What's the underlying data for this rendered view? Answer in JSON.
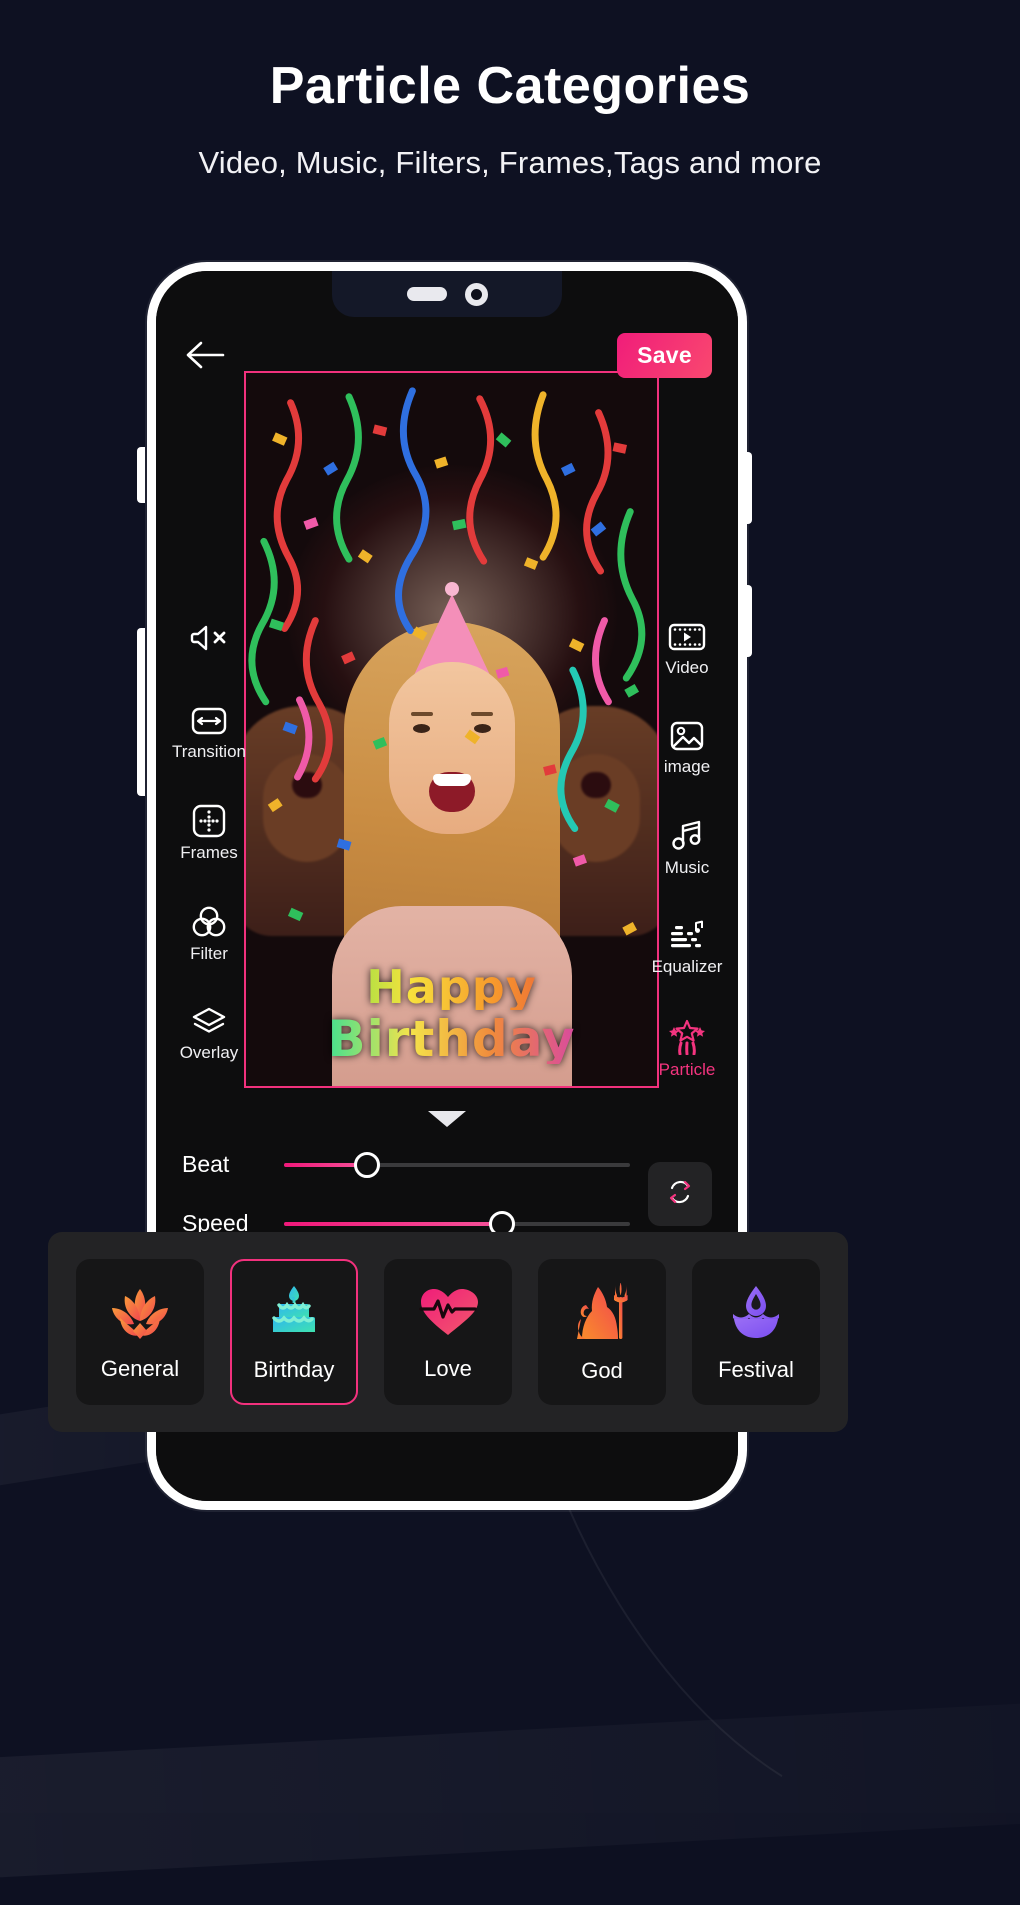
{
  "page": {
    "title": "Particle Categories",
    "subtitle": "Video, Music, Filters, Frames,Tags and more",
    "background_color": "#0e1122",
    "accent_color": "#f2317d"
  },
  "phone": {
    "notch": {
      "speaker_icon": "speaker-pill",
      "camera_icon": "front-camera-icon"
    },
    "side_buttons": [
      "volume-up",
      "volume-down",
      "power",
      "assistant"
    ]
  },
  "app_header": {
    "back_icon": "back-arrow-icon",
    "save_label": "Save"
  },
  "preview": {
    "border_color": "#f2317d",
    "overlay_text_line1": "Happy",
    "overlay_text_line2": "Birthday",
    "scene": "birthday-confetti-photo"
  },
  "left_toolbar": [
    {
      "icon": "mute-icon",
      "label": ""
    },
    {
      "icon": "transition-icon",
      "label": "Transition"
    },
    {
      "icon": "frames-icon",
      "label": "Frames"
    },
    {
      "icon": "filter-icon",
      "label": "Filter"
    },
    {
      "icon": "overlay-icon",
      "label": "Overlay"
    }
  ],
  "right_toolbar": [
    {
      "icon": "video-icon",
      "label": "Video",
      "active": false
    },
    {
      "icon": "image-icon",
      "label": "image",
      "active": false
    },
    {
      "icon": "music-icon",
      "label": "Music",
      "active": false
    },
    {
      "icon": "equalizer-icon",
      "label": "Equalizer",
      "active": false
    },
    {
      "icon": "particle-icon",
      "label": "Particle",
      "active": true
    }
  ],
  "collapse_chevron": "chevron-down-icon",
  "controls": {
    "sliders": [
      {
        "label": "Beat",
        "value": 24
      },
      {
        "label": "Speed",
        "value": 63
      }
    ],
    "reset_icon": "refresh-icon"
  },
  "categories": [
    {
      "label": "General",
      "icon": "lotus-icon",
      "selected": false
    },
    {
      "label": "Birthday",
      "icon": "cake-icon",
      "selected": true
    },
    {
      "label": "Love",
      "icon": "heartbeat-icon",
      "selected": false
    },
    {
      "label": "God",
      "icon": "shiva-icon",
      "selected": false
    },
    {
      "label": "Festival",
      "icon": "diya-icon",
      "selected": false
    }
  ]
}
